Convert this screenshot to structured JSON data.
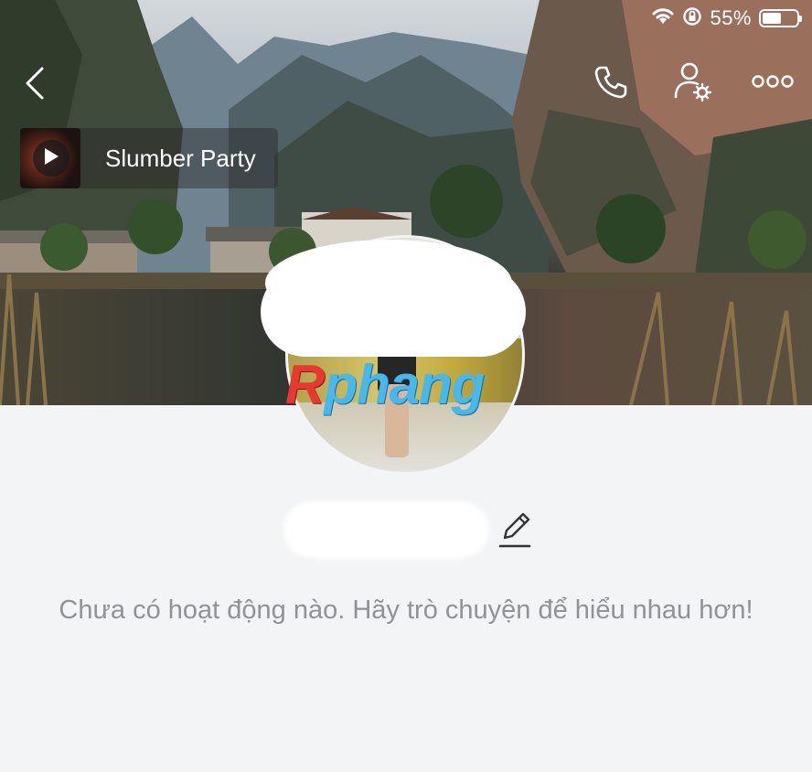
{
  "status_bar": {
    "battery_text": "55%",
    "battery_level": 0.55
  },
  "music": {
    "title": "Slumber Party"
  },
  "avatar": {
    "watermark_first": "R",
    "watermark_rest": "phang"
  },
  "empty_state": {
    "message": "Chưa có hoạt động nào. Hãy trò chuyện để hiểu nhau hơn!"
  },
  "colors": {
    "accent_watermark_blue": "#49b8e8",
    "accent_watermark_red": "#e43a32",
    "message_gray": "#8f9397",
    "page_bg": "#f2f4f5"
  }
}
